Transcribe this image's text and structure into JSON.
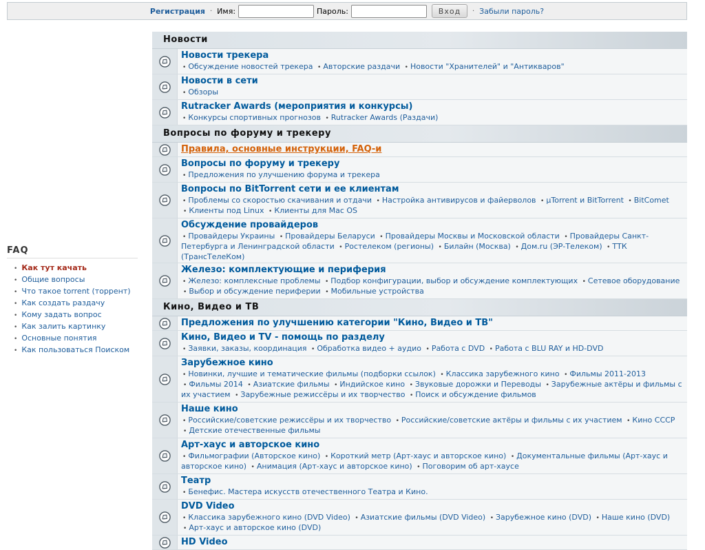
{
  "topbar": {
    "register": "Регистрация",
    "name_label": "Имя:",
    "name_value": "",
    "password_label": "Пароль:",
    "password_value": "",
    "login_button": "Вход",
    "forgot": "Забыли пароль?"
  },
  "faq": {
    "title": "FAQ",
    "items": [
      {
        "label": "Как тут качать",
        "active": true
      },
      {
        "label": "Общие вопросы"
      },
      {
        "label": "Что такое torrent (торрент)"
      },
      {
        "label": "Как создать раздачу"
      },
      {
        "label": "Кому задать вопрос"
      },
      {
        "label": "Как залить картинку"
      },
      {
        "label": "Основные понятия"
      },
      {
        "label": "Как пользоваться Поиском"
      }
    ]
  },
  "categories": [
    {
      "title": "Новости",
      "forums": [
        {
          "title": "Новости трекера",
          "subs": [
            "Обсуждение новостей трекера",
            "Авторские раздачи",
            "Новости \"Хранителей\" и \"Антикваров\""
          ]
        },
        {
          "title": "Новости в сети",
          "subs": [
            "Обзоры"
          ]
        },
        {
          "title": "Rutracker Awards (мероприятия и конкурсы)",
          "subs": [
            "Конкурсы спортивных прогнозов",
            "Rutracker Awards (Раздачи)"
          ]
        }
      ]
    },
    {
      "title": "Вопросы по форуму и трекеру",
      "forums": [
        {
          "title": "Правила, основные инструкции, FAQ-и",
          "subs": [],
          "hot": true
        },
        {
          "title": "Вопросы по форуму и трекеру",
          "subs": [
            "Предложения по улучшению форума и трекера"
          ]
        },
        {
          "title": "Вопросы по BitTorrent сети и ее клиентам",
          "subs": [
            "Проблемы со скоростью скачивания и отдачи",
            "Настройка антивирусов и файерволов",
            "µTorrent и BitTorrent",
            "BitComet",
            "Клиенты под Linux",
            "Клиенты для Mac OS"
          ]
        },
        {
          "title": "Обсуждение провайдеров",
          "subs": [
            "Провайдеры Украины",
            "Провайдеры Беларуси",
            "Провайдеры Москвы и Московской области",
            "Провайдеры Санкт-Петербурга и Ленинградской области",
            "Ростелеком (регионы)",
            "Билайн (Москва)",
            "Дом.ru (ЭР-Телеком)",
            "ТТК (ТрансТелеКом)"
          ]
        },
        {
          "title": "Железо: комплектующие и периферия",
          "subs": [
            "Железо: комплексные проблемы",
            "Подбор конфигурации, выбор и обсуждение комплектующих",
            "Сетевое оборудование",
            "Выбор и обсуждение периферии",
            "Мобильные устройства"
          ]
        }
      ]
    },
    {
      "title": "Кино, Видео и ТВ",
      "forums": [
        {
          "title": "Предложения по улучшению категории \"Кино, Видео и ТВ\"",
          "subs": []
        },
        {
          "title": "Кино, Видео и TV - помощь по разделу",
          "subs": [
            "Заявки, заказы, координация",
            "Обработка видео + аудио",
            "Работа с DVD",
            "Работа с BLU RAY и HD-DVD"
          ]
        },
        {
          "title": "Зарубежное кино",
          "subs": [
            "Новинки, лучшие и тематические фильмы (подборки ссылок)",
            "Классика зарубежного кино",
            "Фильмы 2011-2013",
            "Фильмы 2014",
            "Азиатские фильмы",
            "Индийское кино",
            "Звуковые дорожки и Переводы",
            "Зарубежные актёры и фильмы с их участием",
            "Зарубежные режиссёры и их творчество",
            "Поиск и обсуждение фильмов"
          ]
        },
        {
          "title": "Наше кино",
          "subs": [
            "Российские/советские режиссёры и их творчество",
            "Российские/советские актёры и фильмы с их участием",
            "Кино СССР",
            "Детские отечественные фильмы"
          ]
        },
        {
          "title": "Арт-хаус и авторское кино",
          "subs": [
            "Фильмографии (Авторское кино)",
            "Короткий метр (Арт-хаус и авторское кино)",
            "Документальные фильмы (Арт-хаус и авторское кино)",
            "Анимация (Арт-хаус и авторское кино)",
            "Поговорим об арт-хаусе"
          ]
        },
        {
          "title": "Театр",
          "subs": [
            "Бенефис. Мастера искусств отечественного Театра и Кино."
          ]
        },
        {
          "title": "DVD Video",
          "subs": [
            "Классика зарубежного кино (DVD Video)",
            "Азиатские фильмы (DVD Video)",
            "Зарубежное кино (DVD)",
            "Наше кино (DVD)",
            "Арт-хаус и авторское кино (DVD)"
          ]
        },
        {
          "title": "HD Video",
          "subs": []
        }
      ]
    }
  ]
}
